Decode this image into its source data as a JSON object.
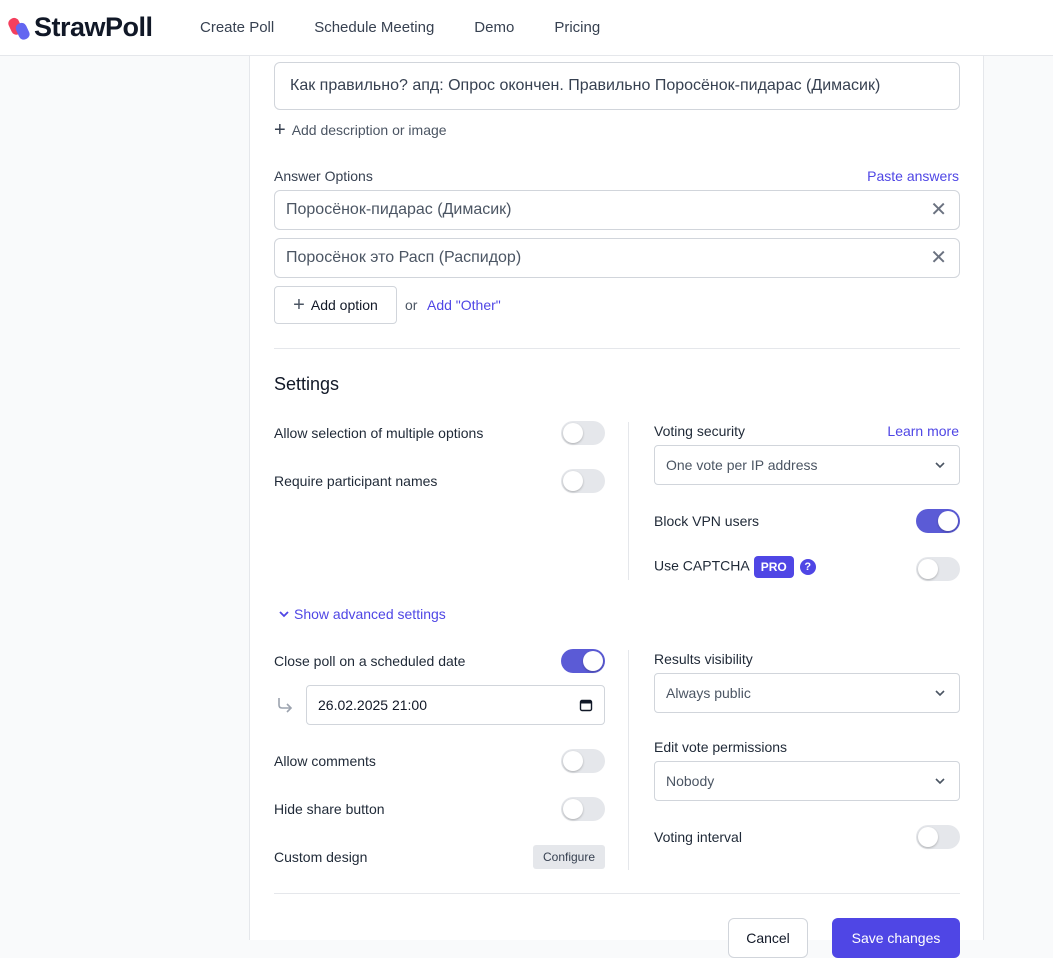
{
  "brand": {
    "name": "StrawPoll",
    "accent": "#4f46e5"
  },
  "nav": [
    "Create Poll",
    "Schedule Meeting",
    "Demo",
    "Pricing"
  ],
  "poll": {
    "title": "Как правильно? апд: Опрос окончен. Правильно Поросёнок-пидарас (Димасик)",
    "add_description": "Add description or image"
  },
  "answers": {
    "label": "Answer Options",
    "paste": "Paste answers",
    "options": [
      "Поросёнок-пидарас (Димасик)",
      "Поросёнок это Расп (Распидор)"
    ],
    "add_option": "Add option",
    "or": "or",
    "add_other": "Add \"Other\""
  },
  "settings": {
    "title": "Settings",
    "multiple": {
      "label": "Allow selection of multiple options",
      "on": false
    },
    "names": {
      "label": "Require participant names",
      "on": false
    },
    "security": {
      "label": "Voting security",
      "learn_more": "Learn more",
      "value": "One vote per IP address"
    },
    "vpn": {
      "label": "Block VPN users",
      "on": true
    },
    "captcha": {
      "label": "Use CAPTCHA",
      "badge": "PRO",
      "help": "?",
      "on": false
    },
    "advanced": "Show advanced settings",
    "close_poll": {
      "label": "Close poll on a scheduled date",
      "on": true,
      "date": "26.02.2025 21:00"
    },
    "comments": {
      "label": "Allow comments",
      "on": false
    },
    "share": {
      "label": "Hide share button",
      "on": false
    },
    "design": {
      "label": "Custom design",
      "button": "Configure"
    },
    "results": {
      "label": "Results visibility",
      "value": "Always public"
    },
    "edit_vote": {
      "label": "Edit vote permissions",
      "value": "Nobody"
    },
    "interval": {
      "label": "Voting interval",
      "on": false
    }
  },
  "actions": {
    "cancel": "Cancel",
    "save": "Save changes"
  }
}
